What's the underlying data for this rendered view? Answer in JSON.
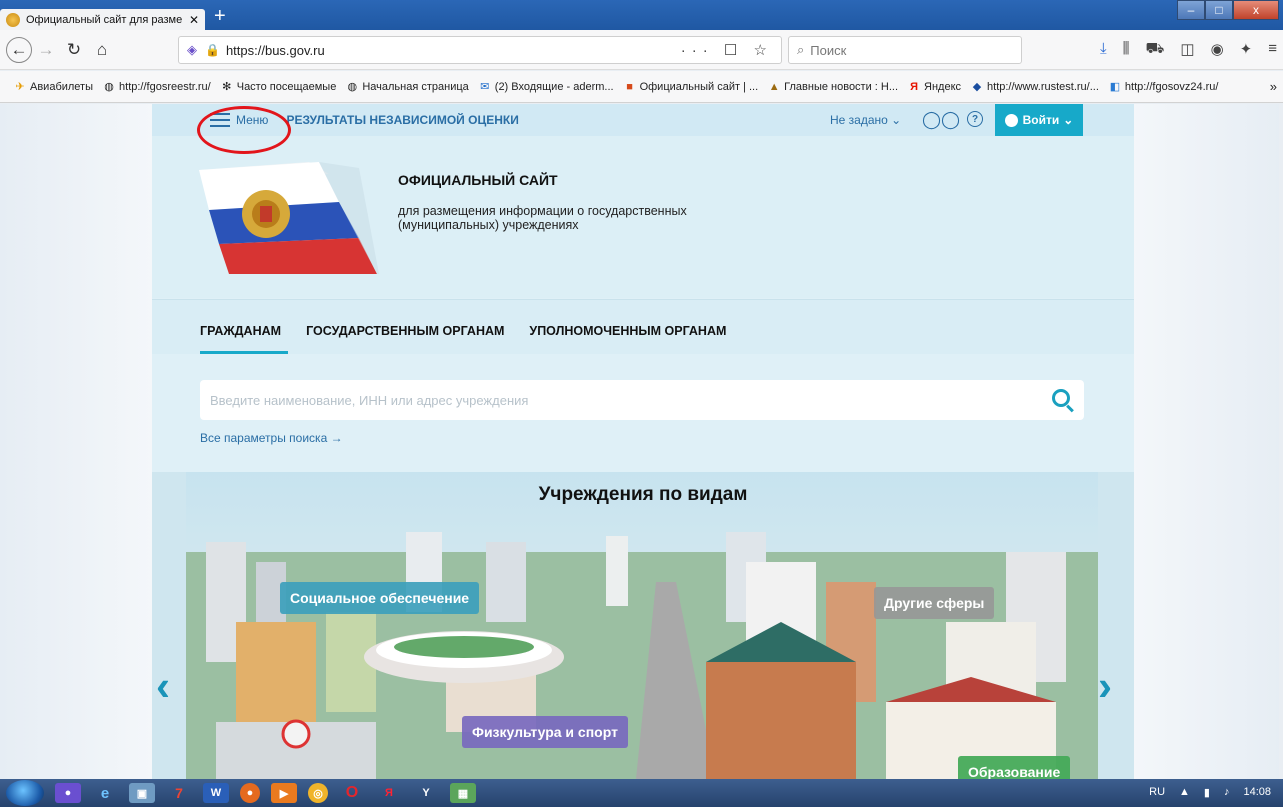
{
  "browser": {
    "tab_title": "Официальный сайт для разме",
    "tab_close": "✕",
    "new_tab": "+",
    "url": "https://bus.gov.ru",
    "url_actions": "··· ☐ ☆",
    "search_placeholder": "Поиск",
    "window_buttons": [
      "–",
      "□",
      "x"
    ]
  },
  "bookmarks": [
    {
      "label": "Авиабилеты",
      "icon": "plane-icon"
    },
    {
      "label": "http://fgosreestr.ru/",
      "icon": "globe-icon"
    },
    {
      "label": "Часто посещаемые",
      "icon": "gear-icon"
    },
    {
      "label": "Начальная страница",
      "icon": "globe-icon"
    },
    {
      "label": "(2) Входящие - aderm...",
      "icon": "mail-icon"
    },
    {
      "label": "Официальный сайт | ...",
      "icon": "site-icon"
    },
    {
      "label": "Главные новости : Н...",
      "icon": "news-icon"
    },
    {
      "label": "Яндекс",
      "icon": "yandex-icon"
    },
    {
      "label": "http://www.rustest.ru/...",
      "icon": "rustest-icon"
    },
    {
      "label": "http://fgosovz24.ru/",
      "icon": "fgos-icon"
    }
  ],
  "site": {
    "menu_label": "Меню",
    "independent_eval": "РЕЗУЛЬТАТЫ НЕЗАВИСИМОЙ ОЦЕНКИ",
    "region": "Не задано",
    "login": "Войти",
    "help": "?",
    "title": "ОФИЦИАЛЬНЫЙ САЙТ",
    "subtitle": "для размещения информации о государственных (муниципальных) учреждениях",
    "sections": [
      "ГРАЖДАНАМ",
      "ГОСУДАРСТВЕННЫМ ОРГАНАМ",
      "УПОЛНОМОЧЕННЫМ ОРГАНАМ"
    ],
    "search_placeholder": "Введите наименование, ИНН или адрес учреждения",
    "all_params": "Все параметры поиска →",
    "banner_title": "Учреждения по видам",
    "banner_tags": {
      "social": "Социальное обеспечение",
      "other": "Другие сферы",
      "sport": "Физкультура и спорт",
      "education": "Образование"
    }
  },
  "taskbar": {
    "lang": "RU",
    "time": "14:08"
  },
  "colors": {
    "accent": "#17a9c9",
    "link": "#2a6ea5",
    "highlight_circle": "#e2151b"
  }
}
